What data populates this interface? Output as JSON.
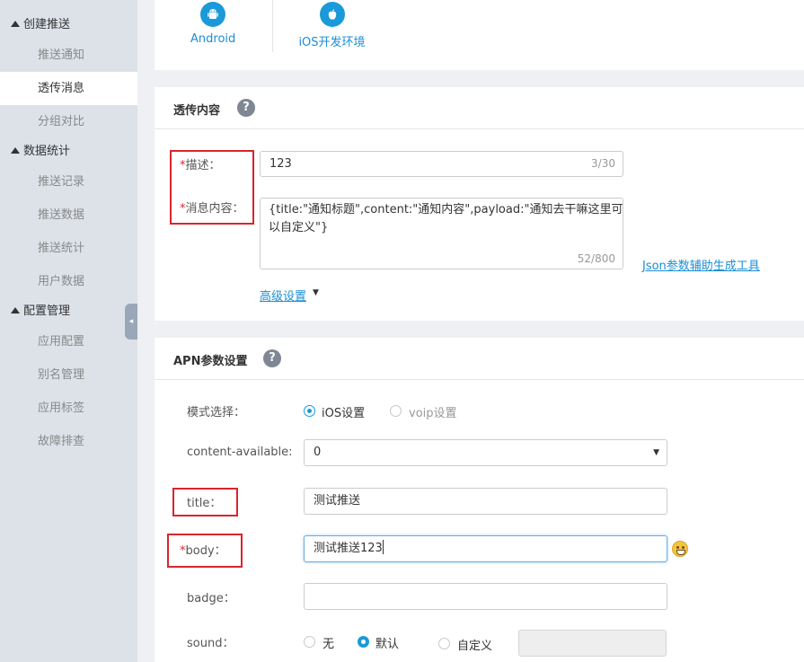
{
  "sidebar": {
    "groups": [
      {
        "label": "创建推送",
        "items": [
          "推送通知",
          "透传消息",
          "分组对比"
        ]
      },
      {
        "label": "数据统计",
        "items": [
          "推送记录",
          "推送数据",
          "推送统计",
          "用户数据"
        ]
      },
      {
        "label": "配置管理",
        "items": [
          "应用配置",
          "别名管理",
          "应用标签",
          "故障排查"
        ]
      }
    ],
    "active_item": "透传消息",
    "collapse_glyph": "◂"
  },
  "platform_tabs": {
    "android": "Android",
    "ios": "iOS开发环境"
  },
  "passthrough": {
    "title": "透传内容",
    "help": "?",
    "desc_label": "描述：",
    "desc_value": "123",
    "desc_count": "3/30",
    "content_label": "消息内容：",
    "content_value": "{title:\"通知标题\",content:\"通知内容\",payload:\"通知去干嘛这里可以自定义\"}",
    "content_count": "52/800",
    "json_tool_link": "Json参数辅助生成工具",
    "advanced_link": "高级设置",
    "required_mark": "*"
  },
  "apn": {
    "title": "APN参数设置",
    "help": "?",
    "mode_label": "模式选择：",
    "mode_options": [
      "iOS设置",
      "voip设置"
    ],
    "mode_selected": "iOS设置",
    "content_available_label": "content-available:",
    "content_available_value": "0",
    "title_label": "title：",
    "title_value": "测试推送",
    "body_label": "body：",
    "body_value": "测试推送123",
    "badge_label": "badge：",
    "badge_value": "",
    "sound_label": "sound：",
    "sound_options": [
      "无",
      "默认",
      "自定义"
    ],
    "sound_selected": "默认",
    "sound_custom_value": ""
  },
  "colors": {
    "accent": "#1a9ad9",
    "highlight_box": "#d9262b",
    "required": "#e0292a"
  }
}
